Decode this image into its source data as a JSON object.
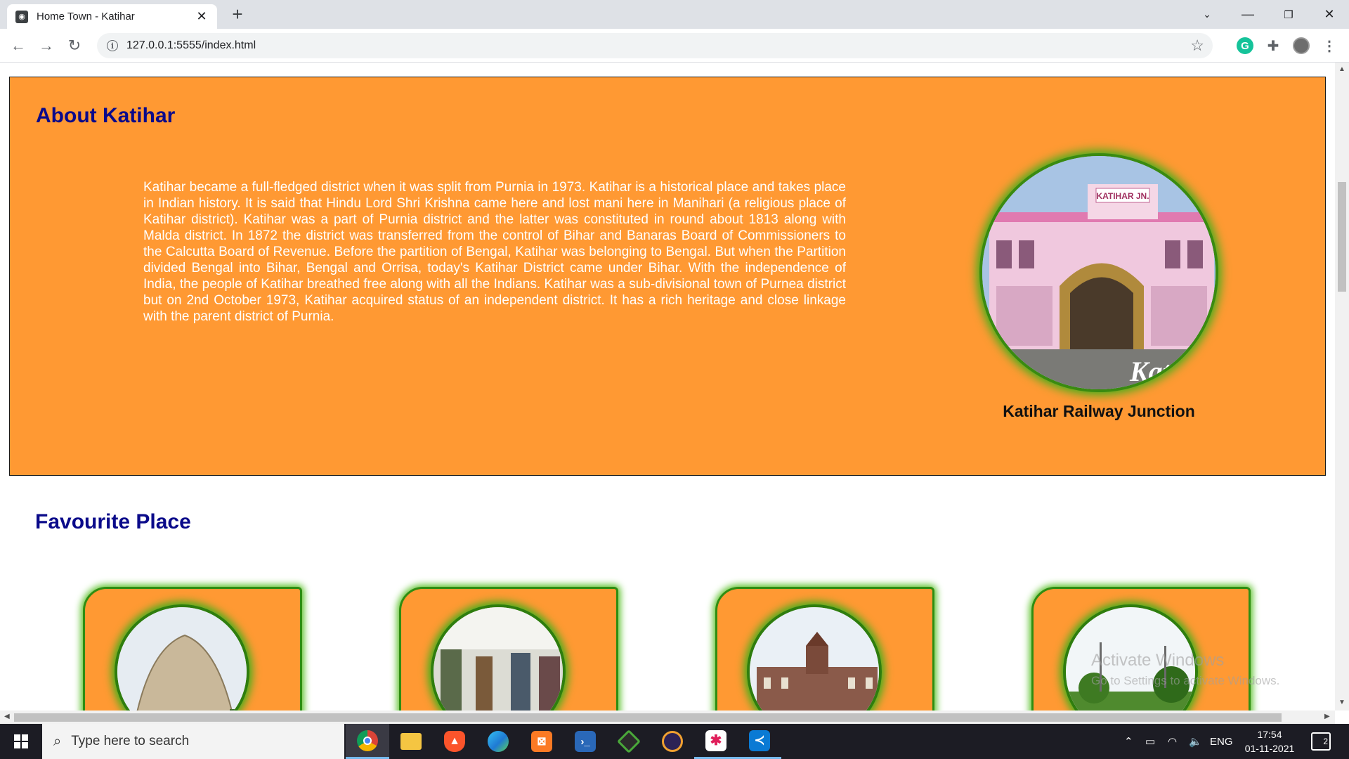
{
  "browser": {
    "tab_title": "Home Town - Katihar",
    "url": "127.0.0.1:5555/index.html"
  },
  "about": {
    "title": "About Katihar",
    "text": "Katihar became a full-fledged district when it was split from Purnia in 1973. Katihar is a historical place and takes place in Indian history. It is said that Hindu Lord Shri Krishna came here and lost mani here in Manihari (a religious place of Katihar district). Katihar was a part of Purnia district and the latter was constituted in round about 1813 along with Malda district. In 1872 the district was transferred from the control of Bihar and Banaras Board of Commissioners to the Calcutta Board of Revenue. Before the partition of Bengal, Katihar was belonging to Bengal. But when the Partition divided Bengal into Bihar, Bengal and Orrisa, today's Katihar District came under Bihar. With the independence of India, the people of Katihar breathed free along with all the Indians. Katihar was a sub-divisional town of Purnea district but on 2nd October 1973, Katihar acquired status of an independent district. It has a rich heritage and close linkage with the parent district of Purnia.",
    "photo_sign": "KATIHAR JN.",
    "photo_overlay": "Kat",
    "photo_caption": "Katihar Railway Junction"
  },
  "favourites": {
    "title": "Favourite Place"
  },
  "watermark": {
    "line1": "Activate Windows",
    "line2": "Go to Settings to activate Windows."
  },
  "taskbar": {
    "search_placeholder": "Type here to search",
    "language": "ENG",
    "time": "17:54",
    "date": "01-11-2021",
    "notification_count": "2"
  },
  "colors": {
    "orange": "#ff9933",
    "heading_blue": "#0a0a8a",
    "green_glow": "#3cb01a"
  }
}
